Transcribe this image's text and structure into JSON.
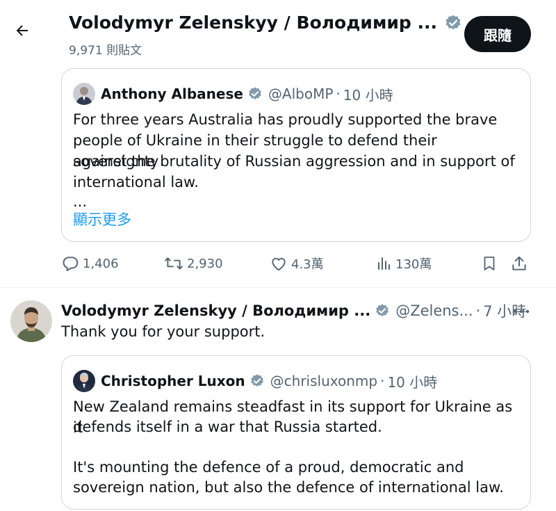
{
  "header": {
    "title": "Volodymyr Zelenskyy / Володимир ...",
    "post_count": "9,971 則貼文",
    "follow_label": "跟隨"
  },
  "quote1": {
    "name": "Anthony Albanese",
    "handle": "@AlboMP",
    "separator": "·",
    "time": "10 小時",
    "lines": [
      "For three years Australia has proudly supported the brave",
      "people of Ukraine in their struggle to defend their sovereignty",
      "against the brutality of Russian aggression and in support of",
      "international law."
    ],
    "ellipsis": "...",
    "show_more": "顯示更多"
  },
  "actions": {
    "replies": "1,406",
    "reposts": "2,930",
    "likes": "4.3萬",
    "views": "130萬"
  },
  "tweet": {
    "name": "Volodymyr Zelenskyy / Володимир ...",
    "handle": "@Zelens...",
    "separator": "·",
    "time": "7 小時",
    "text": "Thank you for your support."
  },
  "quote2": {
    "name": "Christopher Luxon",
    "handle": "@chrisluxonmp",
    "separator": "·",
    "time": "10 小時",
    "lines": [
      "New Zealand remains steadfast in its support for Ukraine as it",
      "defends itself in a war that Russia started.",
      "",
      "It's mounting the defence of a proud, democratic and",
      "sovereign nation, but also the defence of international law."
    ]
  },
  "colors": {
    "verified_badge": "#829aab",
    "link": "#1d9bf0",
    "secondary_text": "#536471",
    "follow_button": "#0f1419"
  },
  "icons": [
    "back-arrow-icon",
    "verified-badge-icon",
    "reply-icon",
    "repost-icon",
    "like-icon",
    "views-icon",
    "bookmark-icon",
    "share-icon",
    "more-options-icon"
  ]
}
